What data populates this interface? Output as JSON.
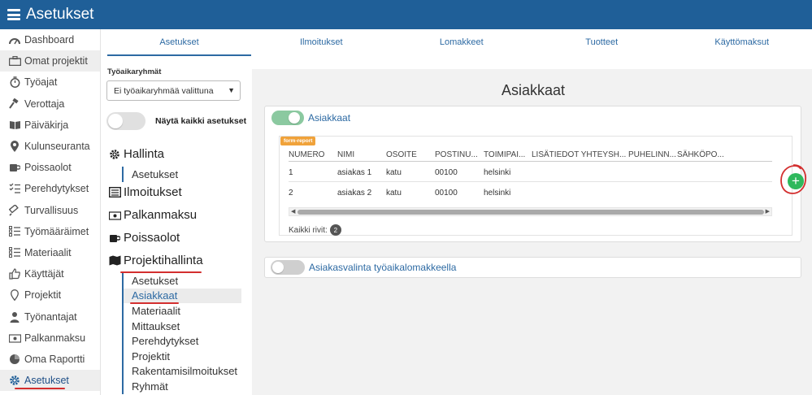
{
  "app": {
    "title": "Asetukset"
  },
  "sidebar": {
    "items": [
      {
        "label": "Dashboard",
        "icon": "dashboard-icon"
      },
      {
        "label": "Omat projektit",
        "icon": "briefcase-icon"
      },
      {
        "label": "Työajat",
        "icon": "stopwatch-icon"
      },
      {
        "label": "Verottaja",
        "icon": "gavel-icon"
      },
      {
        "label": "Päiväkirja",
        "icon": "book-icon"
      },
      {
        "label": "Kulunseuranta",
        "icon": "map-marker-icon"
      },
      {
        "label": "Poissaolot",
        "icon": "coffee-icon"
      },
      {
        "label": "Perehdytykset",
        "icon": "checklist-icon"
      },
      {
        "label": "Turvallisuus",
        "icon": "shield-icon"
      },
      {
        "label": "Työmääräimet",
        "icon": "list-icon"
      },
      {
        "label": "Materiaalit",
        "icon": "list-icon"
      },
      {
        "label": "Käyttäjät",
        "icon": "thumbs-up-icon"
      },
      {
        "label": "Projektit",
        "icon": "map-marker-icon"
      },
      {
        "label": "Työnantajat",
        "icon": "user-icon"
      },
      {
        "label": "Palkanmaksu",
        "icon": "money-icon"
      },
      {
        "label": "Oma Raportti",
        "icon": "pie-chart-icon"
      },
      {
        "label": "Asetukset",
        "icon": "gear-icon"
      }
    ]
  },
  "tabs": [
    "Asetukset",
    "Ilmoitukset",
    "Lomakkeet",
    "Tuotteet",
    "Käyttömaksut"
  ],
  "settings_nav": {
    "workgroup_label": "Työaikaryhmät",
    "workgroup_value": "Ei työaikaryhmää valittuna",
    "show_all_label": "Näytä kaikki asetukset",
    "hallinta": {
      "title": "Hallinta",
      "items": [
        "Asetukset"
      ]
    },
    "ilmoitukset": {
      "title": "Ilmoitukset"
    },
    "palkanmaksu": {
      "title": "Palkanmaksu"
    },
    "poissaolot": {
      "title": "Poissaolot"
    },
    "projektihallinta": {
      "title": "Projektihallinta",
      "items": [
        "Asetukset",
        "Asiakkaat",
        "Materiaalit",
        "Mittaukset",
        "Perehdytykset",
        "Projektit",
        "Rakentamisilmoitukset",
        "Ryhmät"
      ]
    }
  },
  "main": {
    "title": "Asiakkaat",
    "customers_toggle_label": "Asiakkaat",
    "badge": "form-report",
    "table": {
      "columns": [
        "NUMERO",
        "NIMI",
        "OSOITE",
        "POSTINU...",
        "TOIMIPAI...",
        "LISÄTIEDOT YHTEYSH...",
        "PUHELINN...",
        "SÄHKÖPO..."
      ],
      "rows": [
        [
          "1",
          "asiakas 1",
          "katu",
          "00100",
          "helsinki"
        ],
        [
          "2",
          "asiakas 2",
          "katu",
          "00100",
          "helsinki"
        ]
      ]
    },
    "all_rows_label": "Kaikki rivit:",
    "all_rows_count": "2",
    "customer_select_label": "Asiakasvalinta työaikalomakkeella"
  },
  "colors": {
    "topbar": "#1f5f98",
    "accent": "#2d6aa3",
    "add": "#2eb85c",
    "badge": "#f0a23a",
    "annotation": "#d32f2f"
  }
}
